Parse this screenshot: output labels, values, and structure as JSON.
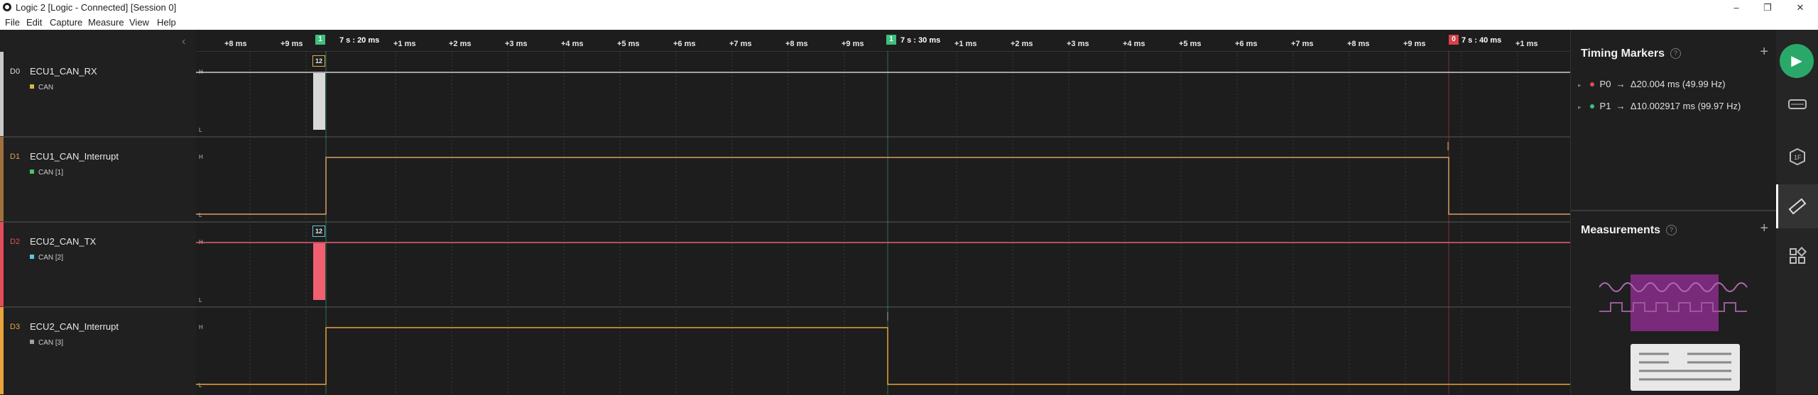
{
  "window": {
    "title": "Logic 2 [Logic - Connected] [Session 0]",
    "min": "–",
    "max": "❐",
    "close": "✕"
  },
  "menu": [
    "File",
    "Edit",
    "Capture",
    "Measure",
    "View",
    "Help"
  ],
  "ruler": {
    "ticks1": [
      "+8 ms",
      "+9 ms"
    ],
    "major1": "7 s : 20 ms",
    "ticks2": [
      "+1 ms",
      "+2 ms",
      "+3 ms",
      "+4 ms",
      "+5 ms",
      "+6 ms",
      "+7 ms",
      "+8 ms",
      "+9 ms"
    ],
    "major2": "7 s : 30 ms",
    "ticks3": [
      "+1 ms",
      "+2 ms",
      "+3 ms",
      "+4 ms",
      "+5 ms",
      "+6 ms",
      "+7 ms",
      "+8 ms",
      "+9 ms"
    ],
    "major3": "7 s : 40 ms",
    "ticks4": [
      "+1 ms"
    ],
    "flag1": "1",
    "flag2": "1",
    "flag0": "0"
  },
  "channels": [
    {
      "id": "D0",
      "name": "ECU1_CAN_RX",
      "analyzer": "CAN",
      "color": "#c8c8c8",
      "dot": "#d8b44a",
      "high": "H",
      "low": "L",
      "badge": "12"
    },
    {
      "id": "D1",
      "name": "ECU1_CAN_Interrupt",
      "analyzer": "CAN [1]",
      "color": "#a0703c",
      "dot": "#4ac26b",
      "high": "H",
      "low": "L"
    },
    {
      "id": "D2",
      "name": "ECU2_CAN_TX",
      "analyzer": "CAN [2]",
      "color": "#e44c5c",
      "dot": "#5ac8e0",
      "high": "H",
      "low": "L",
      "badge": "12"
    },
    {
      "id": "D3",
      "name": "ECU2_CAN_Interrupt",
      "analyzer": "CAN [3]",
      "color": "#e8a33a",
      "dot": "#a0a0a0",
      "high": "H",
      "low": "L"
    }
  ],
  "timing": {
    "title": "Timing Markers",
    "help": "?",
    "add": "+",
    "markers": [
      {
        "label": "P0",
        "arrow": "→",
        "value": "Δ20.004 ms (49.99 Hz)",
        "color": "#e04a5a"
      },
      {
        "label": "P1",
        "arrow": "→",
        "value": "Δ10.002917 ms (99.97 Hz)",
        "color": "#3fbf7f"
      }
    ]
  },
  "measurements": {
    "title": "Measurements",
    "help": "?",
    "add": "+"
  },
  "sidebar": {
    "play": "▶",
    "analyzers_icon": "analyzers-icon",
    "extensions_icon": "extensions-icon",
    "timing_icon": "ruler-icon",
    "layout_icon": "layout-icon"
  },
  "collapse": "‹"
}
